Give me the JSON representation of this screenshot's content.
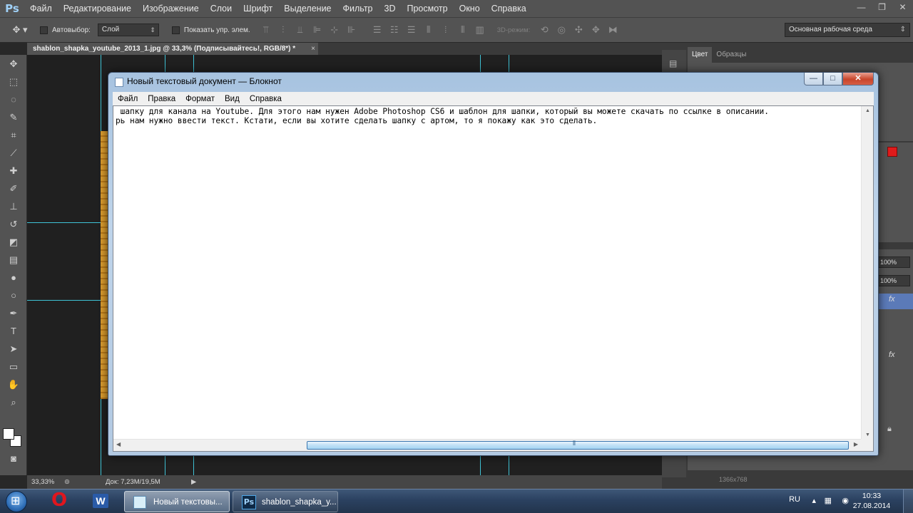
{
  "photoshop": {
    "logo": "Ps",
    "menu": [
      "Файл",
      "Редактирование",
      "Изображение",
      "Слои",
      "Шрифт",
      "Выделение",
      "Фильтр",
      "3D",
      "Просмотр",
      "Окно",
      "Справка"
    ],
    "window_controls": {
      "minimize": "—",
      "restore": "❐",
      "close": "✕"
    },
    "options": {
      "move_tool_icon": "✥ ▾",
      "auto_select_label": "Автовыбор:",
      "auto_select_value": "Слой",
      "show_transform_label": "Показать упр. элем.",
      "mode_3d_label": "3D-режим:",
      "workspace_value": "Основная рабочая среда"
    },
    "document_tab": {
      "title": "shablon_shapka_youtube_2013_1.jpg @ 33,3% (Подписывайтесь!, RGB/8*) *",
      "close": "×"
    },
    "status": {
      "zoom": "33,33%",
      "doc_info": "Док: 7,23M/19,5M"
    },
    "panels": {
      "tabs": [
        "Цвет",
        "Образцы"
      ],
      "opacity_1": "100%",
      "opacity_2": "100%",
      "fx_label": "fx",
      "fx_label_2": "fx",
      "dimensions_partial": "1366x768"
    },
    "accent_colors": {
      "guide": "#3fc3d6",
      "swatch": "#e01b1b"
    }
  },
  "notepad": {
    "title": "Новый текстовый документ — Блокнот",
    "controls": {
      "minimize": "—",
      "maximize": "□",
      "close": "✕"
    },
    "menu": [
      "Файл",
      "Правка",
      "Формат",
      "Вид",
      "Справка"
    ],
    "content": " шапку для канала на Youtube. Для этого нам нужен Adobe Photoshop CS6 и шаблон для шапки, который вы можете скачать по ссылке в описании.\nрь нам нужно ввести текст. Кстати, если вы хотите сделать шапку с артом, то я покажу как это сделать."
  },
  "taskbar": {
    "tasks": [
      {
        "label": "Новый текстовы..."
      },
      {
        "label": "shablon_shapka_y...",
        "icon_text": "Ps"
      }
    ],
    "language": "RU",
    "time": "10:33",
    "date": "27.08.2014"
  }
}
